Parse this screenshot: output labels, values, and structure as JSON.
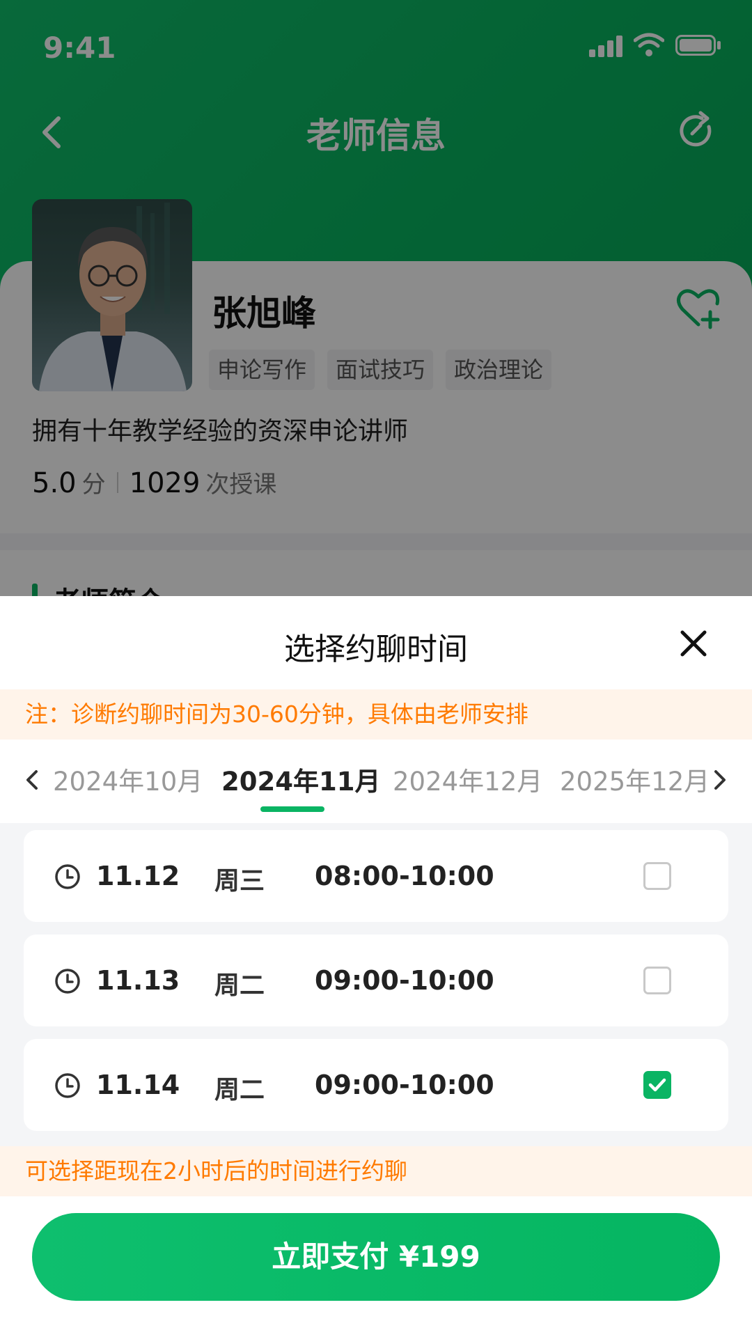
{
  "status_bar": {
    "time": "9:41"
  },
  "nav": {
    "title": "老师信息"
  },
  "teacher": {
    "name": "张旭峰",
    "tags": [
      "申论写作",
      "面试技巧",
      "政治理论"
    ],
    "intro": "拥有十年教学经验的资深申论讲师",
    "rating": "5.0",
    "rating_unit": "分",
    "lessons": "1029",
    "lessons_unit": "次授课",
    "section_title": "老师简介"
  },
  "sheet": {
    "title": "选择约聊时间",
    "notice": "注：诊断约聊时间为30-60分钟，具体由老师安排",
    "months": [
      "2024年10月",
      "2024年11月",
      "2024年12月",
      "2025年12月"
    ],
    "active_month_index": 1,
    "slots": [
      {
        "date": "11.12",
        "weekday": "周三",
        "time": "08:00-10:00",
        "checked": false
      },
      {
        "date": "11.13",
        "weekday": "周二",
        "time": "09:00-10:00",
        "checked": false
      },
      {
        "date": "11.14",
        "weekday": "周二",
        "time": "09:00-10:00",
        "checked": true
      }
    ],
    "hint": "可选择距现在2小时后的时间进行约聊",
    "pay_button": "立即支付 ¥199"
  },
  "colors": {
    "brand": "#0ab463",
    "warning": "#ff7a00",
    "warning_bg": "#fff4ea"
  },
  "icons": [
    "back-icon",
    "refresh-icon",
    "heart-add-icon",
    "close-icon",
    "chevron-left-icon",
    "chevron-right-icon",
    "clock-icon",
    "checkbox-icon"
  ]
}
